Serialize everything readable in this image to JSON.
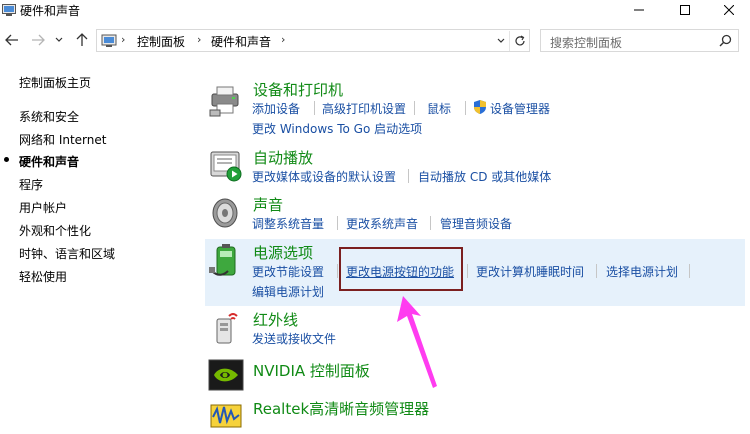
{
  "window": {
    "title": "硬件和声音"
  },
  "address": {
    "crumbs": [
      "控制面板",
      "硬件和声音"
    ]
  },
  "search": {
    "placeholder": "搜索控制面板"
  },
  "leftnav": {
    "items": [
      {
        "label": "控制面板主页",
        "current": false
      },
      {
        "label": "系统和安全",
        "current": false
      },
      {
        "label": "网络和 Internet",
        "current": false
      },
      {
        "label": "硬件和声音",
        "current": true
      },
      {
        "label": "程序",
        "current": false
      },
      {
        "label": "用户帐户",
        "current": false
      },
      {
        "label": "外观和个性化",
        "current": false
      },
      {
        "label": "时钟、语言和区域",
        "current": false
      },
      {
        "label": "轻松使用",
        "current": false
      }
    ]
  },
  "categories": {
    "devices": {
      "title": "设备和打印机",
      "links": [
        "添加设备",
        "高级打印机设置",
        "鼠标",
        "设备管理器",
        "更改 Windows To Go 启动选项"
      ]
    },
    "autoplay": {
      "title": "自动播放",
      "links": [
        "更改媒体或设备的默认设置",
        "自动播放 CD 或其他媒体"
      ]
    },
    "sound": {
      "title": "声音",
      "links": [
        "调整系统音量",
        "更改系统声音",
        "管理音频设备"
      ]
    },
    "power": {
      "title": "电源选项",
      "links": [
        "更改节能设置",
        "更改电源按钮的功能",
        "更改计算机睡眠时间",
        "选择电源计划",
        "编辑电源计划"
      ]
    },
    "infrared": {
      "title": "红外线",
      "links": [
        "发送或接收文件"
      ]
    },
    "nvidia": {
      "title": "NVIDIA 控制面板"
    },
    "realtek": {
      "title": "Realtek高清晰音频管理器"
    }
  },
  "colors": {
    "link": "#1a4fa3",
    "category_title": "#108a15",
    "highlight_row": "#e6f1fb",
    "annotation_box": "#7b1f1f",
    "annotation_arrow": "#ff3cf0"
  }
}
